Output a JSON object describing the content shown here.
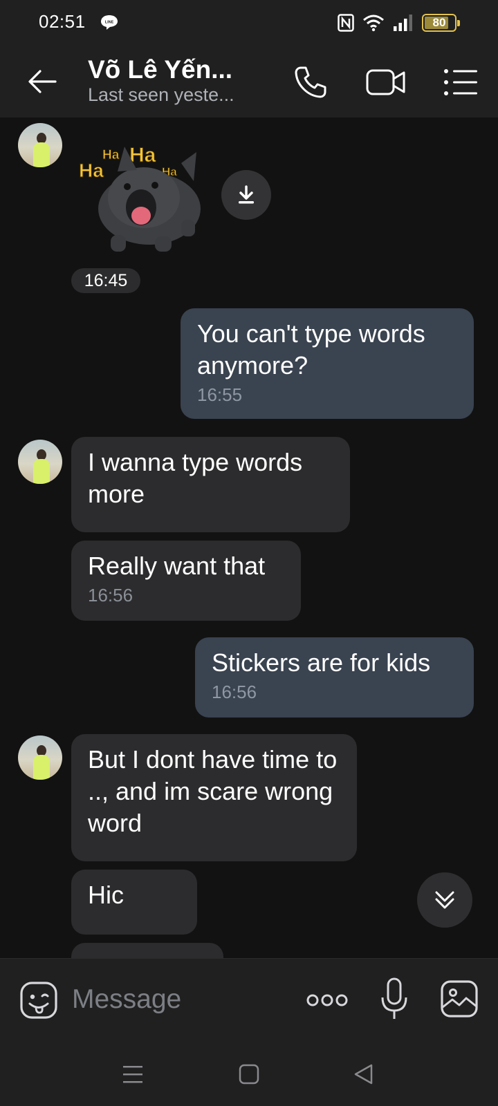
{
  "status_bar": {
    "time": "02:51",
    "battery": "80",
    "battery_level": 0.8
  },
  "header": {
    "contact_name": "Võ Lê Yến...",
    "last_seen": "Last seen yeste..."
  },
  "messages": {
    "sticker_time": "16:45",
    "m1": {
      "text": "You can't type words anymore?",
      "time": "16:55"
    },
    "m2": {
      "text": "I wanna type words more"
    },
    "m3": {
      "text": "Really want that",
      "time": "16:56"
    },
    "m4": {
      "text": "Stickers are for kids",
      "time": "16:56"
    },
    "m5": {
      "text": "But I dont have time to .., and im scare wrong word"
    },
    "m6": {
      "text": "Hic"
    }
  },
  "composer": {
    "placeholder": "Message"
  },
  "colors": {
    "incoming_bubble": "#2c2c2e",
    "outgoing_bubble": "#3a4350",
    "background": "#121212",
    "bars": "#202020",
    "battery": "#e4c24f"
  },
  "icons": {
    "back": "arrow-left-icon",
    "call": "phone-icon",
    "video": "video-camera-icon",
    "menu": "menu-icon",
    "download": "download-icon",
    "scroll": "chevron-double-down-icon",
    "emoji": "sticker-face-icon",
    "more": "more-dots-icon",
    "mic": "microphone-icon",
    "gallery": "gallery-icon"
  }
}
